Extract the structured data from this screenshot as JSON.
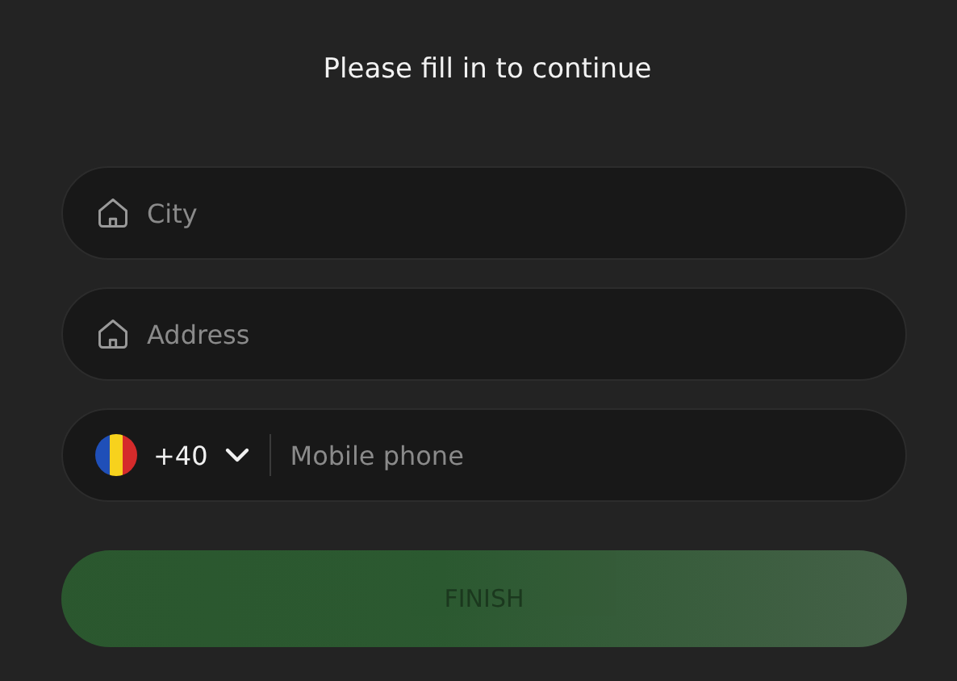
{
  "title": "Please fill in to continue",
  "fields": [
    {
      "kind": "text",
      "placeholder": "City"
    },
    {
      "kind": "text",
      "placeholder": "Address"
    },
    {
      "kind": "phone",
      "code": "+40",
      "placeholder": "Mobile phone"
    }
  ],
  "finish_button": {
    "label": "FINISH",
    "disabled": true
  }
}
